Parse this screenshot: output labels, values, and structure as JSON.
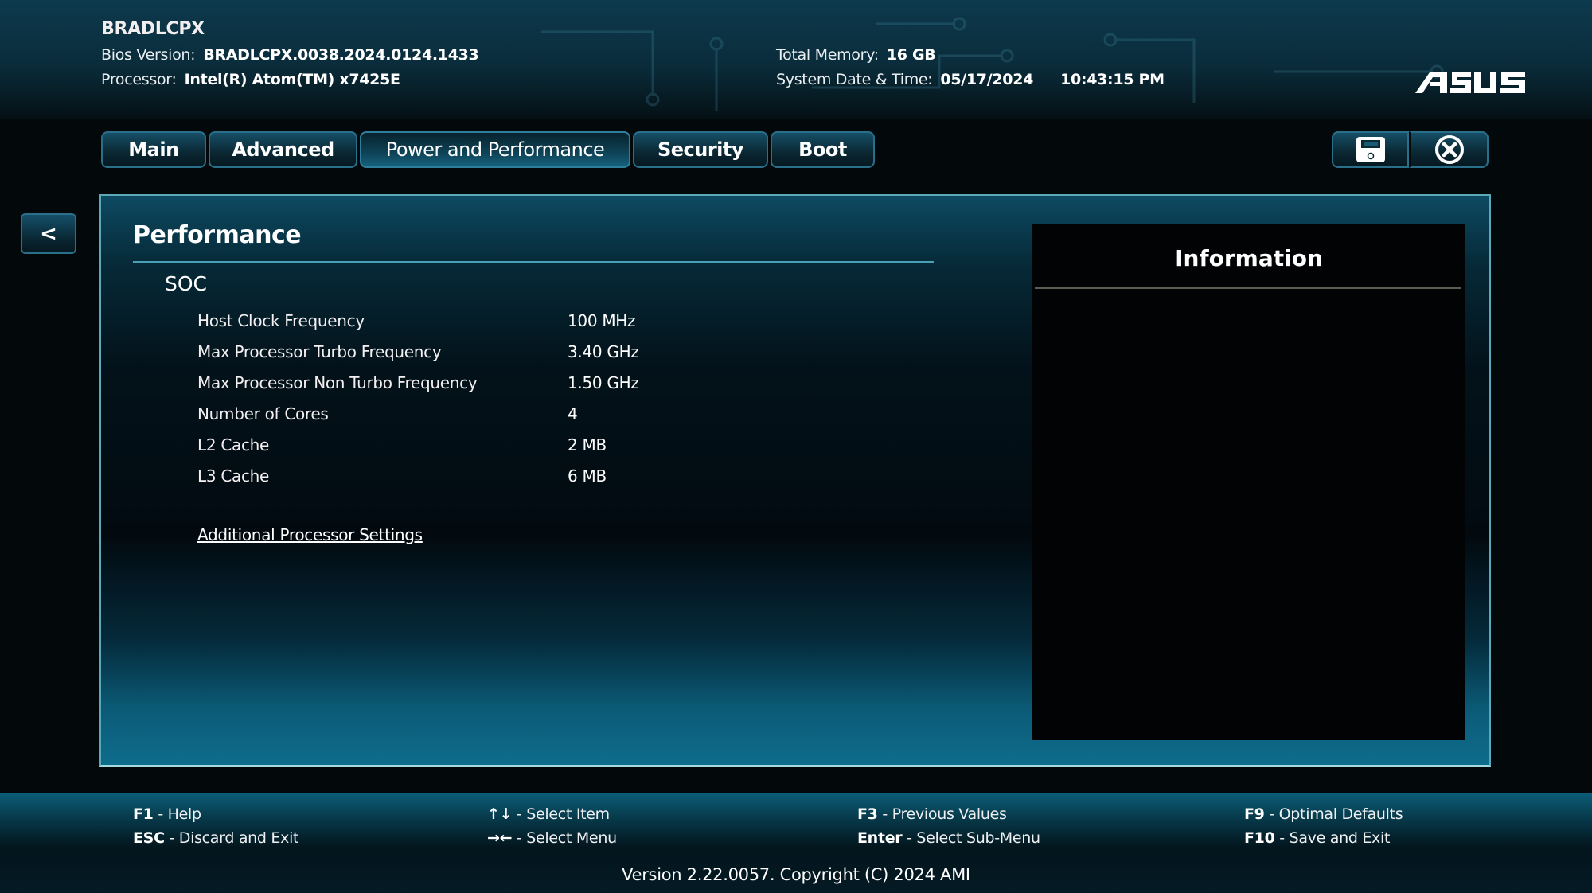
{
  "header": {
    "board_name": "BRADLCPX",
    "bios_version_label": "Bios Version:",
    "bios_version": "BRADLCPX.0038.2024.0124.1433",
    "processor_label": "Processor:",
    "processor": "Intel(R) Atom(TM) x7425E",
    "total_memory_label": "Total Memory:",
    "total_memory": "16 GB",
    "date_time_label": "System Date & Time:",
    "date": "05/17/2024",
    "time": "10:43:15 PM",
    "logo": "ASUS"
  },
  "tabs": [
    {
      "label": "Main",
      "active": false
    },
    {
      "label": "Advanced",
      "active": false
    },
    {
      "label": "Power and Performance",
      "active": true
    },
    {
      "label": "Security",
      "active": false
    },
    {
      "label": "Boot",
      "active": false
    }
  ],
  "actions": {
    "save_icon": "floppy-disk-icon",
    "exit_icon": "circle-x-icon"
  },
  "back_button": {
    "label": "<"
  },
  "page": {
    "title": "Performance",
    "group": "SOC",
    "rows": [
      {
        "label": "Host Clock Frequency",
        "value": "100 MHz"
      },
      {
        "label": "Max Processor Turbo Frequency",
        "value": "3.40 GHz"
      },
      {
        "label": "Max Processor Non Turbo Frequency",
        "value": "1.50 GHz"
      },
      {
        "label": "Number of Cores",
        "value": "4"
      },
      {
        "label": "L2 Cache",
        "value": "2 MB"
      },
      {
        "label": "L3 Cache",
        "value": "6 MB"
      }
    ],
    "submenu_link": "Additional Processor Settings"
  },
  "info_panel": {
    "title": "Information"
  },
  "help": [
    {
      "key": "F1",
      "desc": " - Help"
    },
    {
      "key": "ESC",
      "desc": " - Discard and Exit"
    },
    {
      "key": "↑↓",
      "desc": " - Select Item"
    },
    {
      "key": "→←",
      "desc": " - Select Menu"
    },
    {
      "key": "F3",
      "desc": " - Previous Values"
    },
    {
      "key": "Enter",
      "desc": " - Select Sub-Menu"
    },
    {
      "key": "F9",
      "desc": " - Optimal Defaults"
    },
    {
      "key": "F10",
      "desc": " - Save and Exit"
    }
  ],
  "copyright": "Version 2.22.0057. Copyright (C) 2024 AMI",
  "colors": {
    "accent": "#1a6f8c",
    "panel_border": "#5aa8b8",
    "text": "#ffffff"
  }
}
